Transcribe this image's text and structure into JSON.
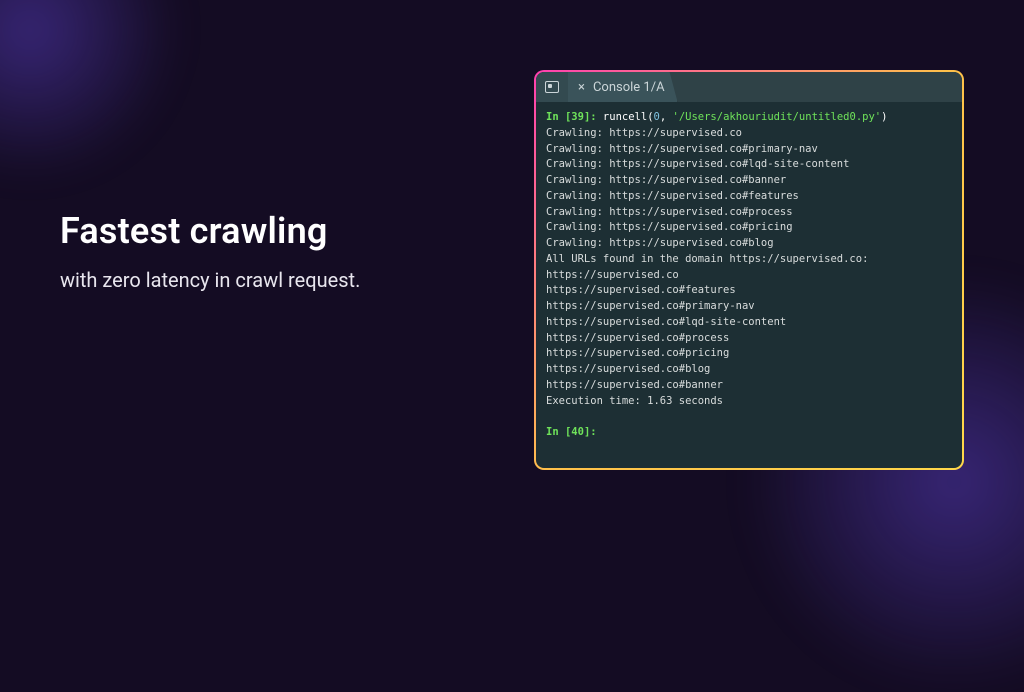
{
  "marketing": {
    "headline": "Fastest crawling",
    "subhead": "with zero latency in crawl request."
  },
  "terminal": {
    "tab_label": "Console 1/A",
    "input_prompt_open": "In [",
    "input_prompt_close": "]: ",
    "in_num_1": "39",
    "fn_name": "runcell",
    "fn_arg0": "0",
    "fn_arg1": "'/Users/akhouriudit/untitled0.py'",
    "lines": [
      "Crawling: https://supervised.co",
      "Crawling: https://supervised.co#primary-nav",
      "Crawling: https://supervised.co#lqd-site-content",
      "Crawling: https://supervised.co#banner",
      "Crawling: https://supervised.co#features",
      "Crawling: https://supervised.co#process",
      "Crawling: https://supervised.co#pricing",
      "Crawling: https://supervised.co#blog",
      "All URLs found in the domain https://supervised.co:",
      "https://supervised.co",
      "https://supervised.co#features",
      "https://supervised.co#primary-nav",
      "https://supervised.co#lqd-site-content",
      "https://supervised.co#process",
      "https://supervised.co#pricing",
      "https://supervised.co#blog",
      "https://supervised.co#banner",
      "Execution time: 1.63 seconds"
    ],
    "in_num_2": "40"
  }
}
